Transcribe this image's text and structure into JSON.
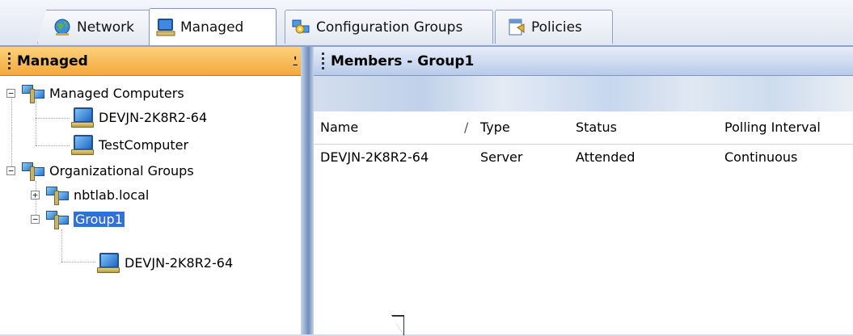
{
  "tabs": [
    {
      "label": "Network",
      "icon": "globe-icon"
    },
    {
      "label": "Managed",
      "icon": "computer-icon"
    },
    {
      "label": "Configuration Groups",
      "icon": "configuration-groups-icon"
    },
    {
      "label": "Policies",
      "icon": "policies-icon"
    }
  ],
  "left_panel": {
    "title": "Managed",
    "pin_glyph": "⍘"
  },
  "tree": [
    {
      "label": "Managed Computers",
      "icon": "group-icon",
      "expander": "−"
    },
    {
      "label": "DEVJN-2K8R2-64",
      "icon": "computer-icon"
    },
    {
      "label": "TestComputer",
      "icon": "computer-icon"
    },
    {
      "label": "Organizational Groups",
      "icon": "group-icon",
      "expander": "−"
    },
    {
      "label": "nbtlab.local",
      "icon": "group-icon",
      "expander": "+"
    },
    {
      "label": "Group1",
      "icon": "group-icon",
      "expander": "−",
      "selected": true
    },
    {
      "label": "DEVJN-2K8R2-64",
      "icon": "computer-icon"
    }
  ],
  "right_panel": {
    "title": "Members - Group1",
    "columns": [
      "Name",
      "Type",
      "Status",
      "Polling Interval"
    ],
    "sort_glyph": "/",
    "rows": [
      [
        "DEVJN-2K8R2-64",
        "Server",
        "Attended",
        "Continuous"
      ]
    ]
  },
  "colors": {
    "left_header": "#f4a93a",
    "selection": "#3170d6",
    "accent_border": "#8da3c6"
  }
}
